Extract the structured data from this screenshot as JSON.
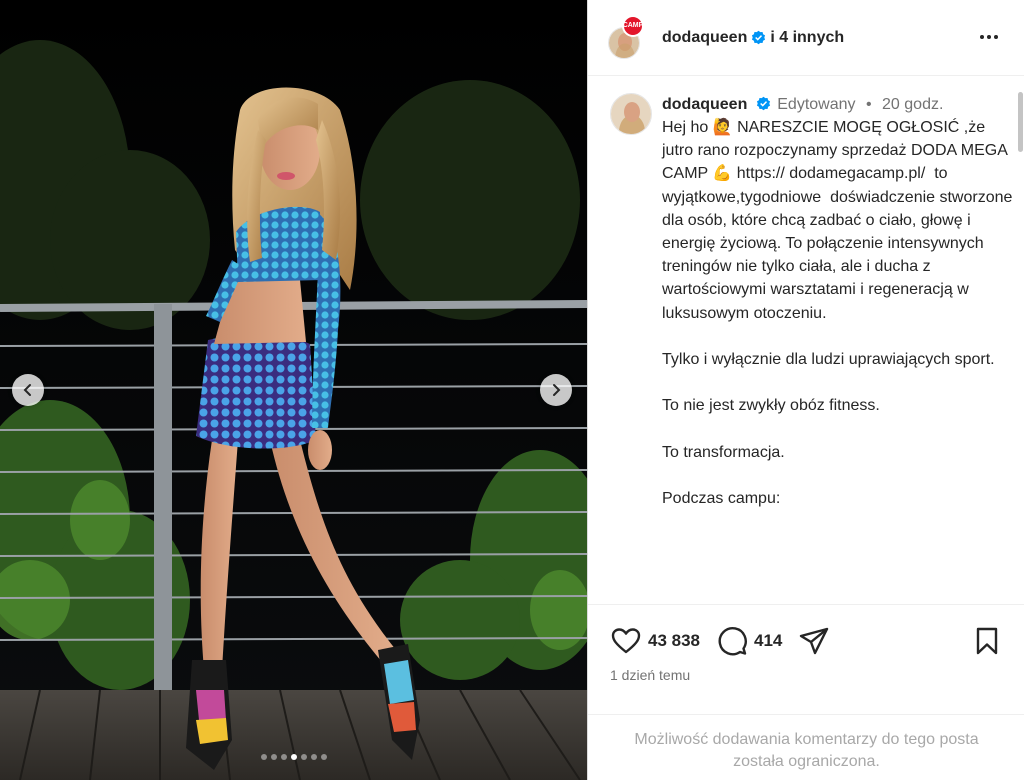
{
  "header": {
    "username": "dodaqueen",
    "others": "i 4 innych",
    "brand_badge": "CAMP"
  },
  "caption": {
    "username": "dodaqueen",
    "edited": "Edytowany",
    "separator": "•",
    "time": "20 godz.",
    "text": "Hej ho 🙋 NARESZCIE MOGĘ OGŁOSIĆ ,że jutro rano rozpoczynamy sprzedaż DODA MEGA CAMP 💪 https:// dodamegacamp.pl/  to wyjątkowe,tygodniowe  doświadczenie stworzone dla osób, które chcą zadbać o ciało, głowę i energię życiową. To połączenie intensywnych treningów nie tylko ciała, ale i ducha z wartościowymi warsztatami i regeneracją w luksusowym otoczeniu.\n\nTylko i wyłącznie dla ludzi uprawiających sport.\n\nTo nie jest zwykły obóz fitness.\n\nTo transformacja.\n\nPodczas campu:"
  },
  "actions": {
    "likes": "43 838",
    "comments": "414",
    "posted": "1 dzień temu"
  },
  "restricted": {
    "line1": "Możliwość dodawania komentarzy do tego posta",
    "line2": "została ograniczona."
  },
  "carousel": {
    "slides": 7,
    "active_index": 3
  },
  "icons": {
    "prev": "chevron-left-icon",
    "next": "chevron-right-icon",
    "like": "heart-icon",
    "comment": "comment-icon",
    "share": "share-icon",
    "save": "bookmark-icon",
    "more": "more-icon",
    "verified": "verified-badge-icon"
  },
  "colors": {
    "verified_blue": "#0095f6",
    "brand_red": "#e3162b",
    "text_primary": "#262626",
    "text_secondary": "#737373"
  }
}
